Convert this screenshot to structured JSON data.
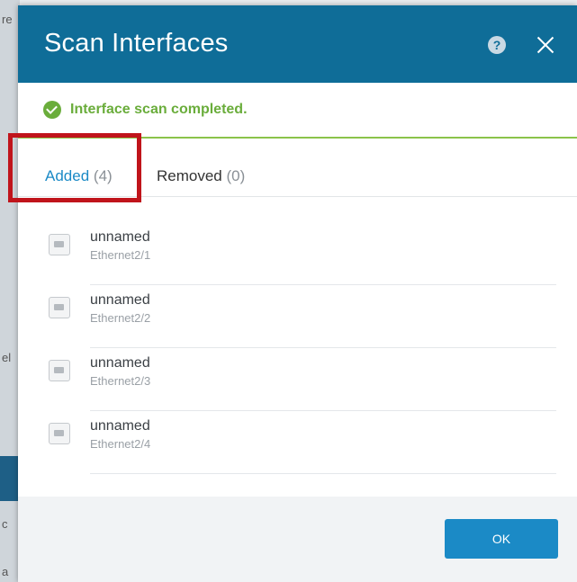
{
  "background": {
    "marks": [
      "re",
      "el",
      "c",
      "a"
    ]
  },
  "dialog": {
    "title": "Scan Interfaces",
    "help_icon": "help-icon",
    "close_icon": "close-icon",
    "status": {
      "icon": "check-circle-icon",
      "text": "Interface scan completed.",
      "color": "#6aad3b"
    },
    "tabs": [
      {
        "label": "Added",
        "count": "(4)",
        "active": true
      },
      {
        "label": "Removed",
        "count": "(0)",
        "active": false
      }
    ],
    "interfaces": [
      {
        "name": "unnamed",
        "port": "Ethernet2/1"
      },
      {
        "name": "unnamed",
        "port": "Ethernet2/2"
      },
      {
        "name": "unnamed",
        "port": "Ethernet2/3"
      },
      {
        "name": "unnamed",
        "port": "Ethernet2/4"
      }
    ],
    "ok_label": "OK"
  },
  "colors": {
    "header": "#0f6d98",
    "accent": "#1b8ac6",
    "success": "#6aad3b",
    "highlight": "#c0141b"
  }
}
